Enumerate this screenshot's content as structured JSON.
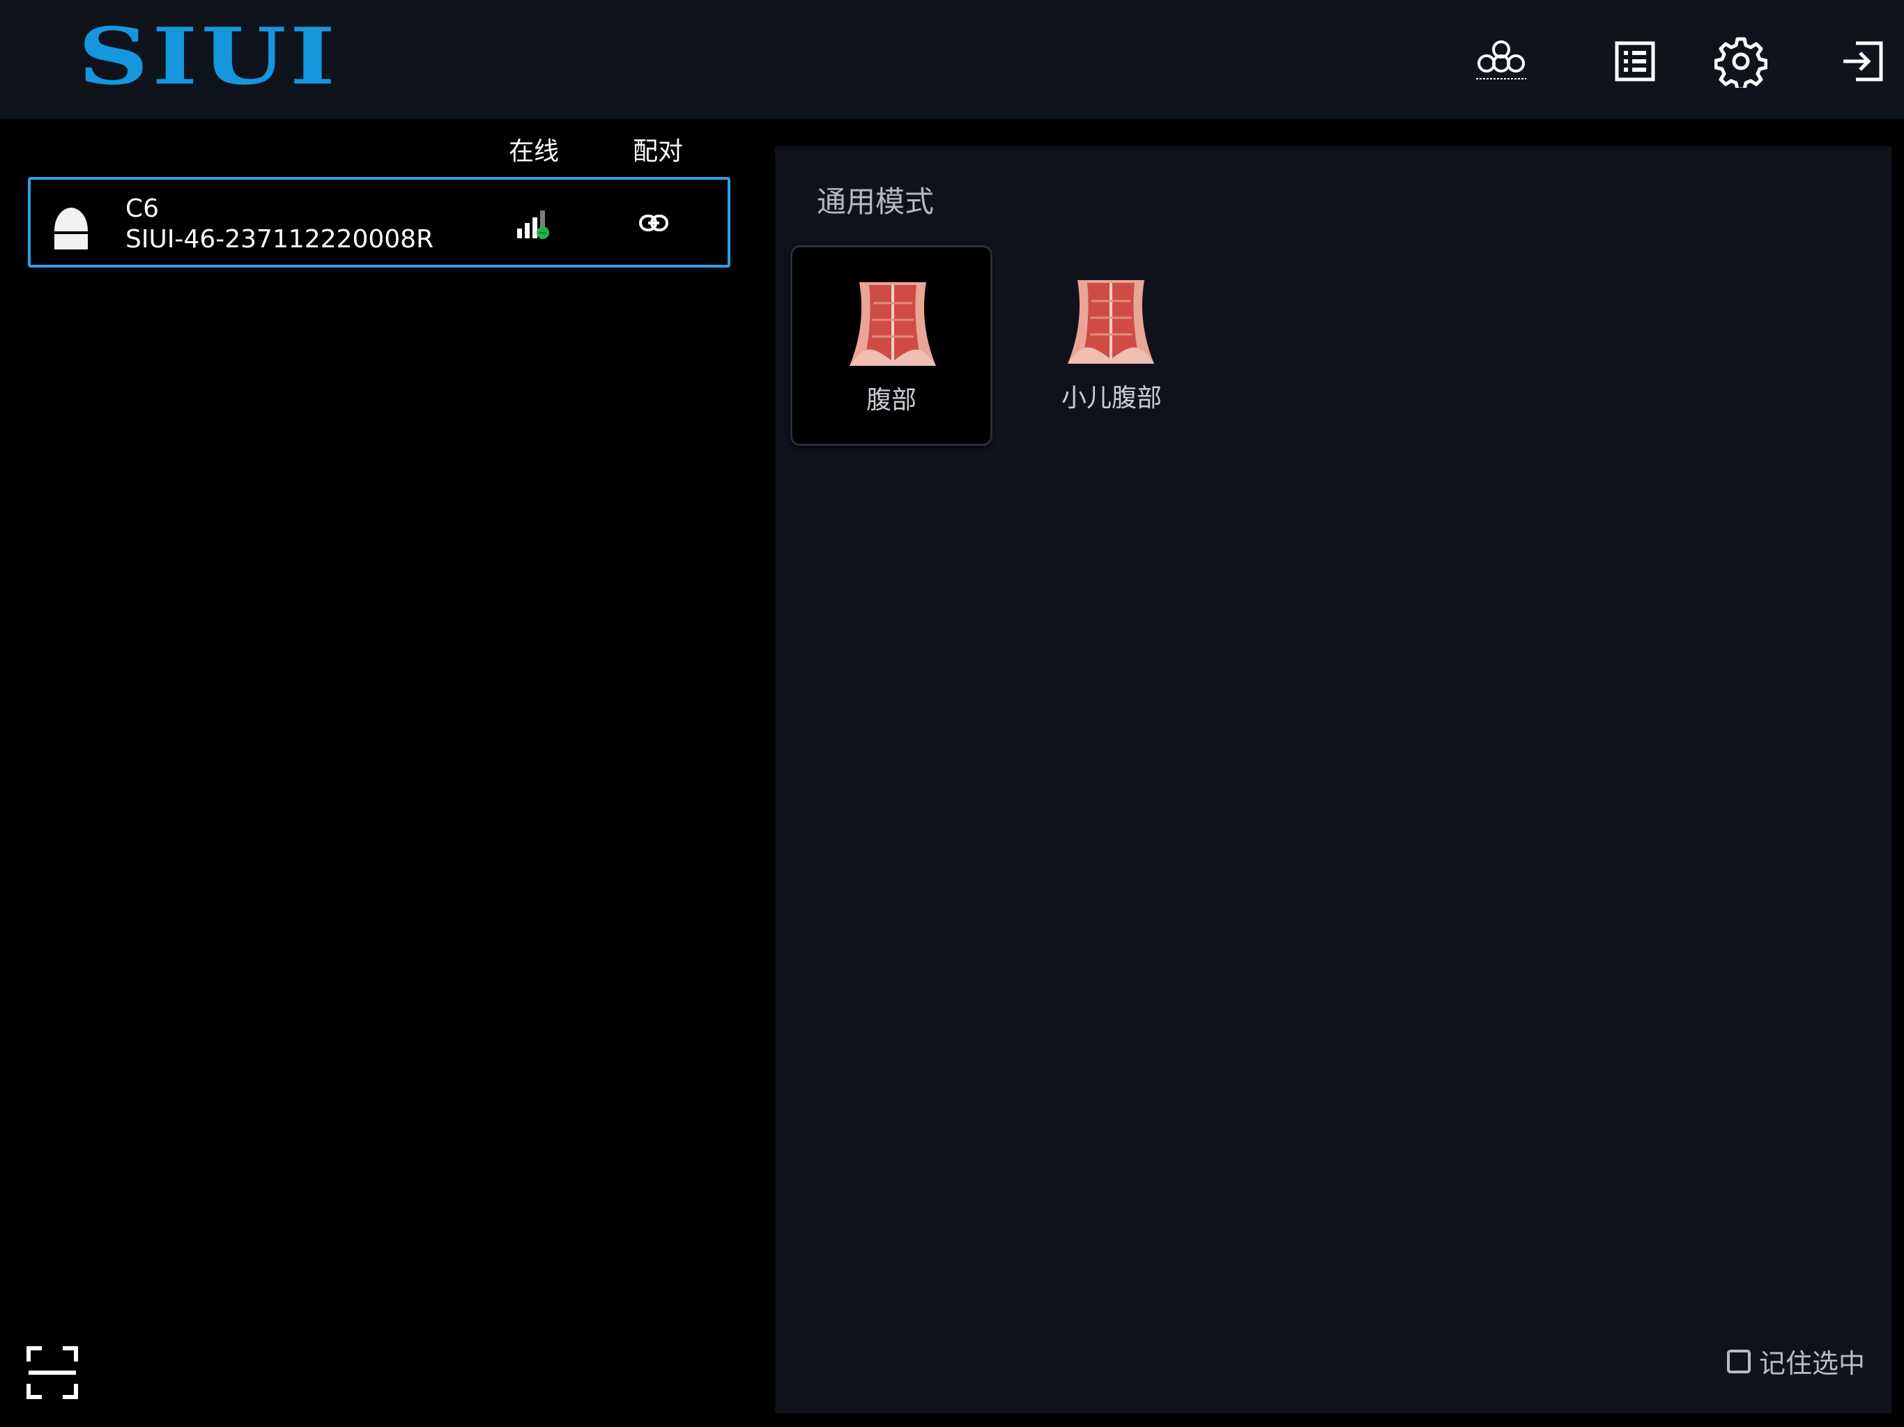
{
  "header": {
    "logo_text": "SIUI",
    "icons": [
      "cloud-icon",
      "list-icon",
      "gear-icon",
      "logout-icon"
    ]
  },
  "device_list": {
    "columns": {
      "online": "在线",
      "pair": "配对"
    },
    "devices": [
      {
        "name": "C6",
        "serial": "SIUI-46-237112220008R",
        "online_icon": "signal-icon",
        "pair_icon": "link-icon"
      }
    ]
  },
  "modes": {
    "section_title": "通用模式",
    "items": [
      {
        "label": "腹部",
        "selected": true
      },
      {
        "label": "小儿腹部",
        "selected": false
      }
    ]
  },
  "footer": {
    "remember_label": "记住选中",
    "remember_checked": false,
    "scan_icon": "scan-icon"
  },
  "colors": {
    "accent": "#1696dc",
    "selection_border": "#2aa0e8",
    "header_bg": "#0f131c",
    "panel_bg": "#0f121b"
  }
}
